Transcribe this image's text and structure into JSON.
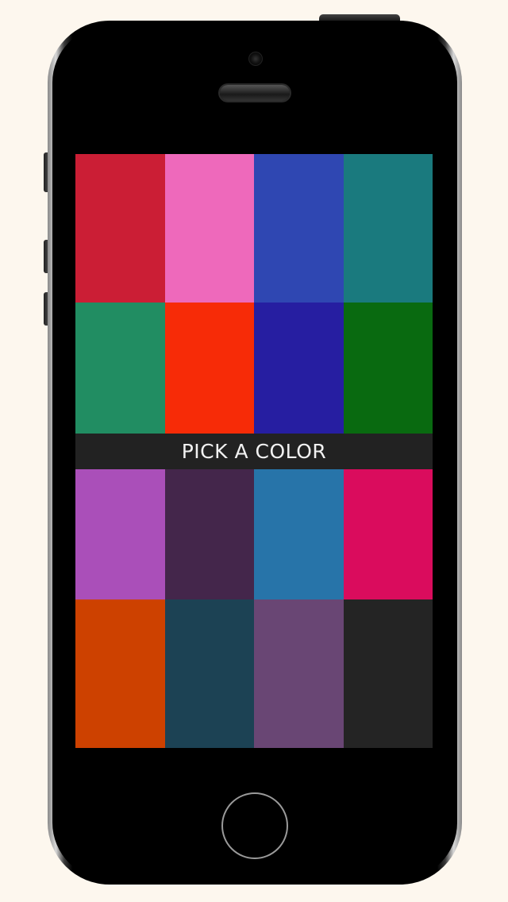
{
  "app": {
    "title": "PICK A COLOR"
  },
  "swatches_top": [
    {
      "name": "crimson",
      "color": "#cb1e35"
    },
    {
      "name": "pink",
      "color": "#ee69bb"
    },
    {
      "name": "royal-blue",
      "color": "#2f47b2"
    },
    {
      "name": "teal",
      "color": "#1a7a7e"
    },
    {
      "name": "green",
      "color": "#218d62"
    },
    {
      "name": "red-orange",
      "color": "#f72b07"
    },
    {
      "name": "indigo",
      "color": "#261ea1"
    },
    {
      "name": "dark-green",
      "color": "#096a10"
    }
  ],
  "swatches_bottom": [
    {
      "name": "purple",
      "color": "#aa4fb9"
    },
    {
      "name": "plum",
      "color": "#44264b"
    },
    {
      "name": "steel-blue",
      "color": "#2774a9"
    },
    {
      "name": "magenta",
      "color": "#da0c5d"
    },
    {
      "name": "burnt-orange",
      "color": "#cd4100"
    },
    {
      "name": "slate",
      "color": "#1c4254"
    },
    {
      "name": "mauve",
      "color": "#694674"
    },
    {
      "name": "charcoal",
      "color": "#242424"
    }
  ],
  "colors": {
    "page_background": "#fdf7ee",
    "title_bar": "#222222",
    "title_text": "#f2f2f2"
  }
}
